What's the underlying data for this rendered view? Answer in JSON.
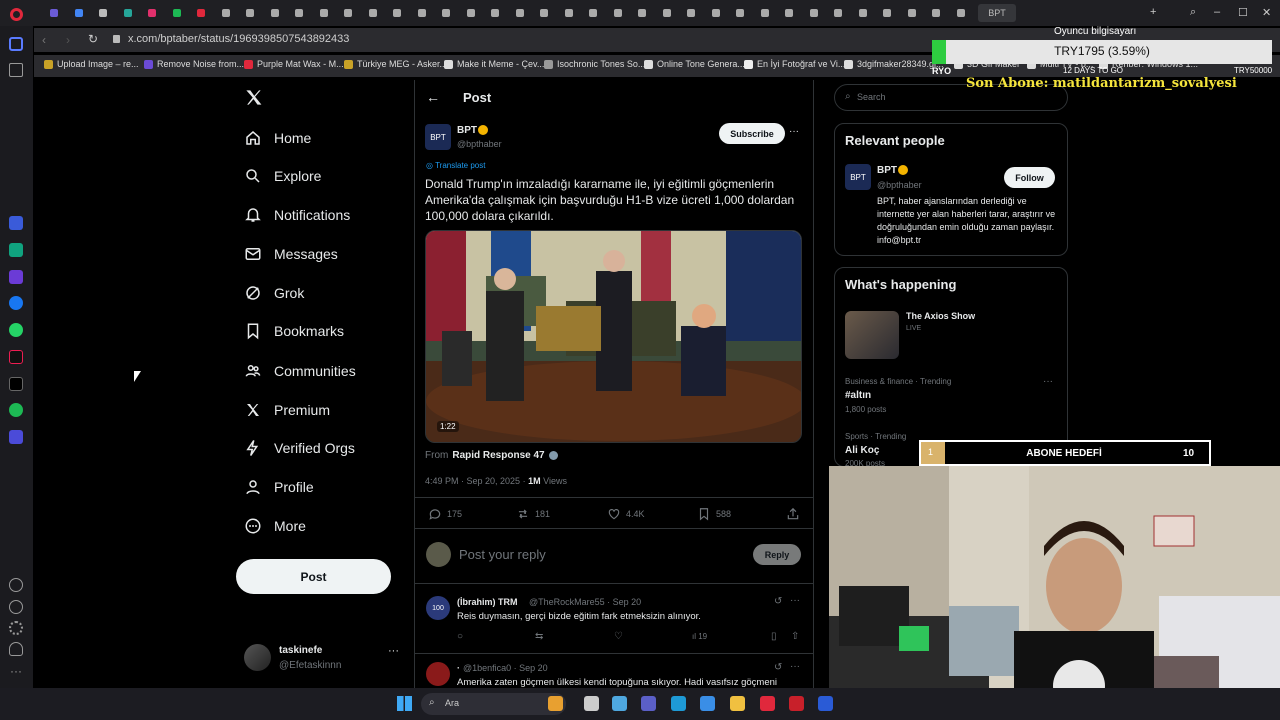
{
  "browser": {
    "url": "x.com/bptaber/status/1969398507543892433",
    "active_tab": "BPT",
    "bookmarks": [
      "Upload Image – re...",
      "Remove Noise from...",
      "Purple Mat Wax - M...",
      "Türkiye MEG - Asker...",
      "Make it Meme - Çev...",
      "Isochronic Tones So...",
      "Online Tone Genera...",
      "En İyi Fotoğraf ve Vi...",
      "3dgifmaker28349.gi...",
      "3D Gif Maker",
      "Multi TV - b...",
      "Rehber: Windows 1..."
    ]
  },
  "nav": {
    "items": [
      "Home",
      "Explore",
      "Notifications",
      "Messages",
      "Grok",
      "Bookmarks",
      "Communities",
      "Premium",
      "Verified Orgs",
      "Profile",
      "More"
    ],
    "post_label": "Post",
    "account_name": "taskinefe",
    "account_handle": "@Efetaskinnn"
  },
  "post": {
    "header": "Post",
    "author_name": "BPT",
    "author_handle": "@bpthaber",
    "subscribe_label": "Subscribe",
    "translate_label": "Translate post",
    "text": "Donald Trump'ın imzaladığı kararname ile, iyi eğitimli göçmenlerin Amerika'da çalışmak için başvurduğu H1-B vize ücreti 1,000 dolardan 100,000 dolara çıkarıldı.",
    "video_duration": "1:22",
    "source_prefix": "From",
    "source_name": "Rapid Response 47",
    "timestamp": "4:49 PM · Sep 20, 2025 ·",
    "views_count": "1M",
    "views_label": "Views",
    "replies": "175",
    "reposts": "181",
    "likes": "4.4K",
    "bookmarks": "588",
    "reply_placeholder": "Post your reply",
    "reply_button": "Reply"
  },
  "replies": [
    {
      "name": "(İbrahim) TRM",
      "handle": "@TheRockMare55 · Sep 20",
      "text": "Reis duymasın, gerçi bizde eğitim fark etmeksizin alınıyor.",
      "views": "19"
    },
    {
      "name": "·",
      "handle": "@1benfica0 · Sep 20",
      "text": "Amerika zaten göçmen ülkesi kendi topuğuna sıkıyor. Hadi vasıfsız göçmeni"
    }
  ],
  "right": {
    "search_placeholder": "Search",
    "relevant_title": "Relevant people",
    "person_name": "BPT",
    "person_handle": "@bpthaber",
    "follow_label": "Follow",
    "person_bio": "BPT, haber ajanslarından derlediği ve internette yer alan haberleri tarar, araştırır ve doğruluğundan emin olduğu zaman paylaşır. info@bpt.tr",
    "happening_title": "What's happening",
    "show_title": "The Axios Show",
    "show_status": "LIVE",
    "trend1_cat": "Business & finance · Trending",
    "trend1_name": "#altın",
    "trend1_posts": "1,800 posts",
    "trend2_cat": "Sports · Trending",
    "trend2_name": "Ali Koç",
    "trend2_posts": "200K posts"
  },
  "stream": {
    "pc_label": "Oyuncu bilgisayarı",
    "currency": "TRY1795 (3.59%)",
    "goal_left": "RYO",
    "goal_mid": "12 DAYS TO GO",
    "goal_right": "TRY50000",
    "last_sub": "Son Abone: matildantarizm_sovalyesi",
    "sub_goal_num": "1",
    "sub_goal_label": "ABONE HEDEFİ",
    "sub_goal_target": "10"
  },
  "taskbar": {
    "search_label": "Ara"
  },
  "colors": {
    "accent": "#1d9bf0",
    "verified": "#f4b400",
    "stream_text": "#f5e53c"
  }
}
